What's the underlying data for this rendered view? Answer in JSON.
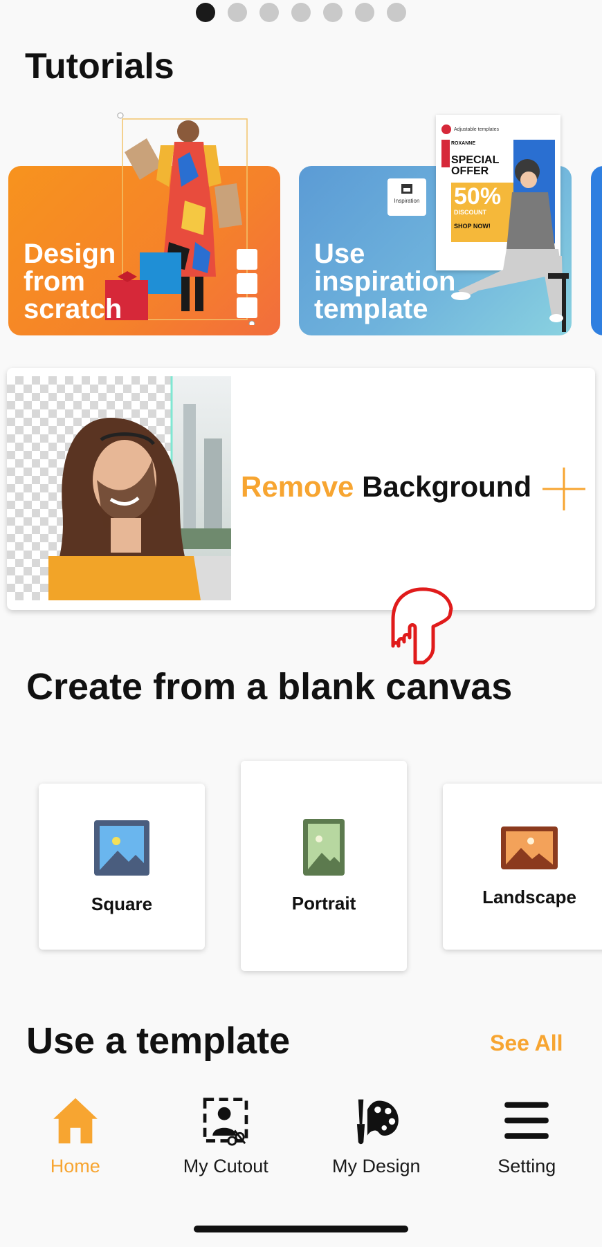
{
  "pager": {
    "count": 7,
    "active_index": 0
  },
  "tutorials": {
    "title": "Tutorials",
    "cards": [
      {
        "label": "Design\nfrom\nscratch"
      },
      {
        "label": "Use\ninspiration\ntemplate",
        "chip": "Inspiration"
      }
    ],
    "flyer": {
      "header": "Adjustable templates",
      "brand": "ROXANNE",
      "special": "SPECIAL",
      "offer": "OFFER",
      "percent": "50%",
      "discount": "DISCOUNT",
      "shop": "SHOP NOW!"
    }
  },
  "remove_bg": {
    "accent": "Remove",
    "rest": "Background"
  },
  "blank_canvas": {
    "title": "Create from a blank canvas",
    "options": [
      {
        "label": "Square",
        "icon": "image-icon",
        "color": "#4a5d7e"
      },
      {
        "label": "Portrait",
        "icon": "image-icon",
        "color": "#5c7a4e"
      },
      {
        "label": "Landscape",
        "icon": "image-icon",
        "color": "#8b3a1e"
      }
    ]
  },
  "templates": {
    "title": "Use a template",
    "see_all": "See All"
  },
  "nav": [
    {
      "label": "Home",
      "icon": "home-icon",
      "active": true
    },
    {
      "label": "My Cutout",
      "icon": "cutout-icon",
      "active": false
    },
    {
      "label": "My Design",
      "icon": "palette-icon",
      "active": false
    },
    {
      "label": "Setting",
      "icon": "menu-icon",
      "active": false
    }
  ],
  "colors": {
    "accent": "#f7a531",
    "design_card": "#f5822a",
    "inspire_card": "#6fb3dc",
    "hand": "#e01b1b"
  }
}
